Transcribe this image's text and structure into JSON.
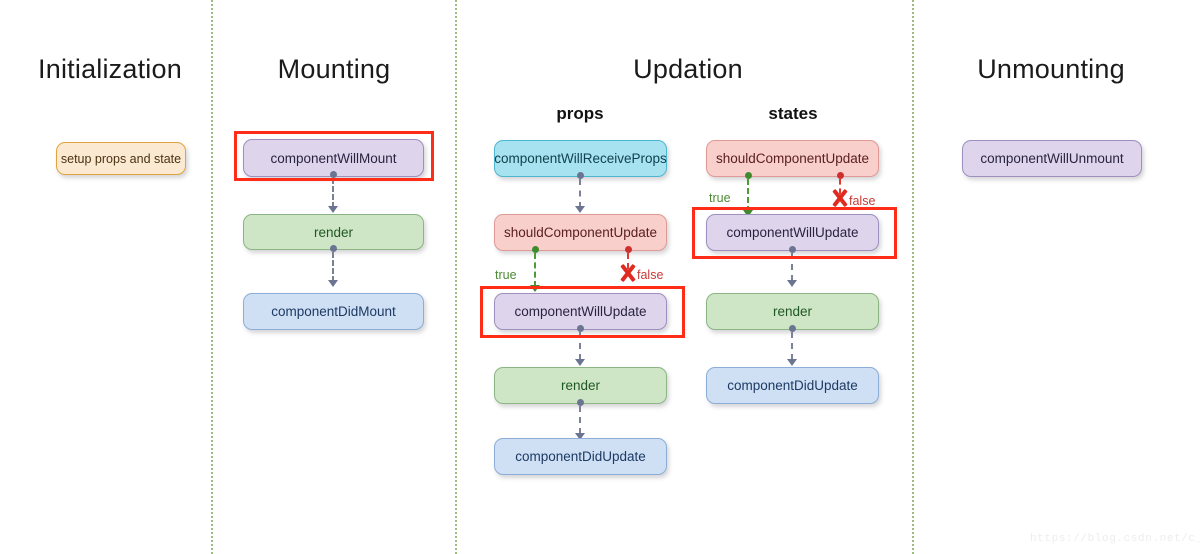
{
  "figure": {
    "watermark": "https://blog.csdn.net/c_kite"
  },
  "phases": [
    {
      "id": "initialization",
      "title": "Initialization"
    },
    {
      "id": "mounting",
      "title": "Mounting"
    },
    {
      "id": "updation",
      "title": "Updation"
    },
    {
      "id": "unmounting",
      "title": "Unmounting"
    }
  ],
  "subheadings": [
    {
      "id": "props",
      "label": "props"
    },
    {
      "id": "states",
      "label": "states"
    }
  ],
  "nodes": {
    "setup_props_and_state": "setup props and state",
    "component_will_mount": "componentWillMount",
    "mount_render": "render",
    "component_did_mount": "componentDidMount",
    "component_will_receive_props": "componentWillReceiveProps",
    "props_should_component_update": "shouldComponentUpdate",
    "props_component_will_update": "componentWillUpdate",
    "props_render": "render",
    "props_component_did_update": "componentDidUpdate",
    "states_should_component_update": "shouldComponentUpdate",
    "states_component_will_update": "componentWillUpdate",
    "states_render": "render",
    "states_component_did_update": "componentDidUpdate",
    "component_will_unmount": "componentWillUnmount"
  },
  "branch_labels": {
    "props_true": "true",
    "props_false": "false",
    "states_true": "true",
    "states_false": "false"
  },
  "colors": {
    "purple_fill": "#ded5ec",
    "purple_border": "#9e8fbe",
    "green_fill": "#cfe6c6",
    "green_border": "#8bb583",
    "blue_fill": "#cfe0f5",
    "blue_border": "#8badd8",
    "cyan_fill": "#a7e2f0",
    "cyan_border": "#4fb6cf",
    "pink_fill": "#f8cfcb",
    "pink_border": "#e09a96",
    "cream_fill": "#fbe9d2",
    "cream_border": "#e2a33f",
    "highlight_red": "#ff2d17",
    "divider_green": "#9bbf7a",
    "true_green": "#4e8a34",
    "false_red": "#c83b34"
  }
}
